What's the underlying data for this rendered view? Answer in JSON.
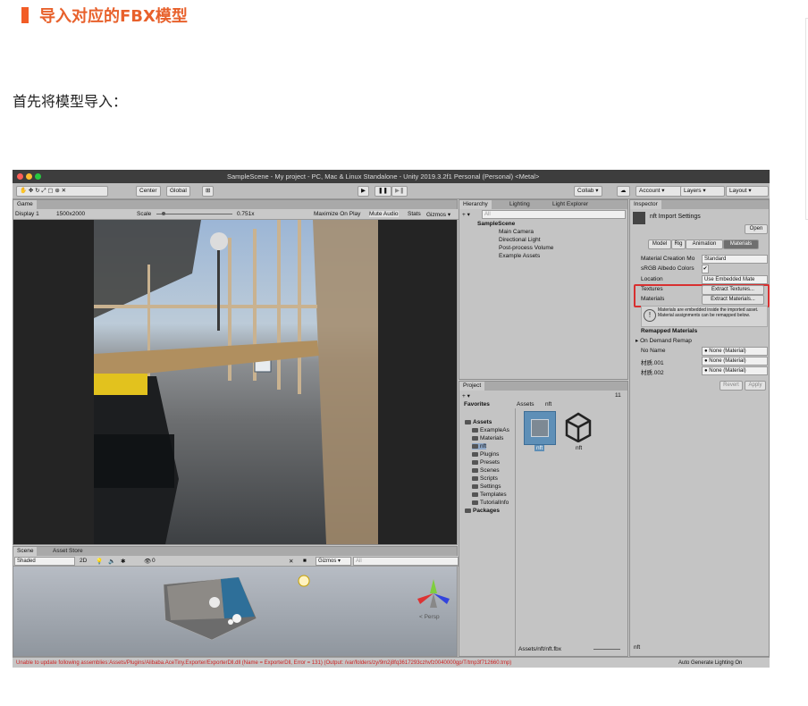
{
  "article": {
    "heading": "导入对应的FBX模型",
    "paragraph": "首先将模型导入："
  },
  "unity": {
    "window_title": "SampleScene - My project - PC, Mac & Linux Standalone - Unity 2019.3.2f1 Personal (Personal) <Metal>",
    "toolbar": {
      "center": "Center",
      "global": "Global",
      "collab": "Collab ▾",
      "account": "Account ▾",
      "layers": "Layers ▾",
      "layout": "Layout ▾"
    },
    "game": {
      "tab": "Game",
      "display": "Display 1",
      "resolution": "1500x2000",
      "scale_label": "Scale",
      "scale_value": "0.751x",
      "maximize": "Maximize On Play",
      "mute": "Mute Audio",
      "stats": "Stats",
      "gizmos": "Gizmos ▾"
    },
    "scene": {
      "tab": "Scene",
      "asset_store_tab": "Asset Store",
      "shading": "Shaded",
      "mode_2d": "2D",
      "layers_count": "0",
      "gizmos": "Gizmos ▾",
      "search_placeholder": "All",
      "persp": "< Persp"
    },
    "hierarchy": {
      "tabs": [
        "Hierarchy",
        "Lighting",
        "Light Explorer"
      ],
      "search_placeholder": "All",
      "scene": "SampleScene",
      "items": [
        "Main Camera",
        "Directional Light",
        "Post-process Volume",
        "Example Assets"
      ]
    },
    "project": {
      "tab": "Project",
      "favorites": "Favorites",
      "breadcrumb": [
        "Assets",
        "nft"
      ],
      "count": "11",
      "tree": [
        "Assets",
        "ExampleAs",
        "Materials",
        "nft",
        "Plugins",
        "Presets",
        "Scenes",
        "Scripts",
        "Settings",
        "Templates",
        "TutorialInfo",
        "Packages"
      ],
      "asset_labels": [
        "nft",
        "nft"
      ],
      "footer_path": "Assets/nft/nft.fbx"
    },
    "inspector": {
      "tab": "Inspector",
      "title": "nft Import Settings",
      "open": "Open",
      "tabs": [
        "Model",
        "Rig",
        "Animation",
        "Materials"
      ],
      "fields": [
        {
          "label": "Material Creation Mo",
          "value": "Standard"
        },
        {
          "label": "sRGB Albedo Colors",
          "value": "✔"
        },
        {
          "label": "Location",
          "value": "Use Embedded Mate"
        }
      ],
      "textures_label": "Textures",
      "textures_btn": "Extract Textures...",
      "materials_label": "Materials",
      "materials_btn": "Extract Materials...",
      "info": "Materials are embedded inside the imported asset. Material assignments can be remapped below.",
      "remapped": "Remapped Materials",
      "on_demand": "On Demand Remap",
      "remap_rows": [
        {
          "label": "No Name",
          "value": "None (Material)"
        },
        {
          "label": "材质.001",
          "value": "None (Material)"
        },
        {
          "label": "材质.002",
          "value": "None (Material)"
        }
      ],
      "revert": "Revert",
      "apply": "Apply",
      "footer": "nft"
    },
    "status": {
      "error": "Unable to update following assemblies:Assets/Plugins/Alibaba.AceTiny.Exporter/ExporterDll.dll (Name = ExporterDll, Error = 131) (Output: /var/folders/zy/9m2j8fq3617293czhvfz0040000gp/T/tmp3f712660.tmp)",
      "lighting": "Auto Generate Lighting On"
    }
  }
}
